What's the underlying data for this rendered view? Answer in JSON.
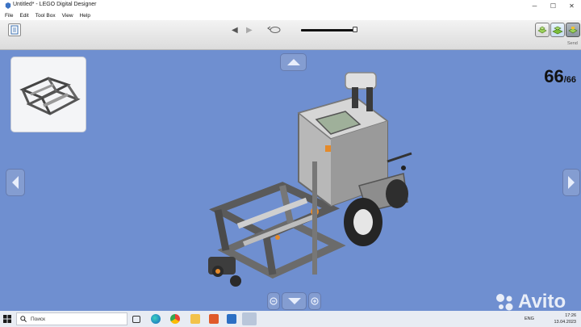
{
  "window": {
    "title": "Untitled* - LEGO Digital Designer"
  },
  "menu": {
    "items": [
      "File",
      "Edit",
      "Tool Box",
      "View",
      "Help"
    ]
  },
  "toolbar": {
    "send_label": "Send"
  },
  "viewer": {
    "step_current": "66",
    "step_total": "/66"
  },
  "taskbar": {
    "search_placeholder": "Поиск",
    "time": "17:26",
    "date": "13.04.2023",
    "lang": "ENG"
  },
  "watermark": {
    "text": "Avito"
  },
  "icons": [
    "app-logo-icon",
    "minimize-icon",
    "maximize-icon",
    "close-icon",
    "document-icon",
    "undo-icon",
    "windows-start-icon",
    "search-icon",
    "task-view-icon",
    "edge-icon",
    "chrome-icon",
    "file-explorer-icon",
    "mail-icon",
    "app-icon",
    "lego-designer-icon"
  ],
  "colors": {
    "viewport": "#6f8fd0",
    "toolbar": "#dcdcdc",
    "accent_green": "#7bbf3a"
  }
}
